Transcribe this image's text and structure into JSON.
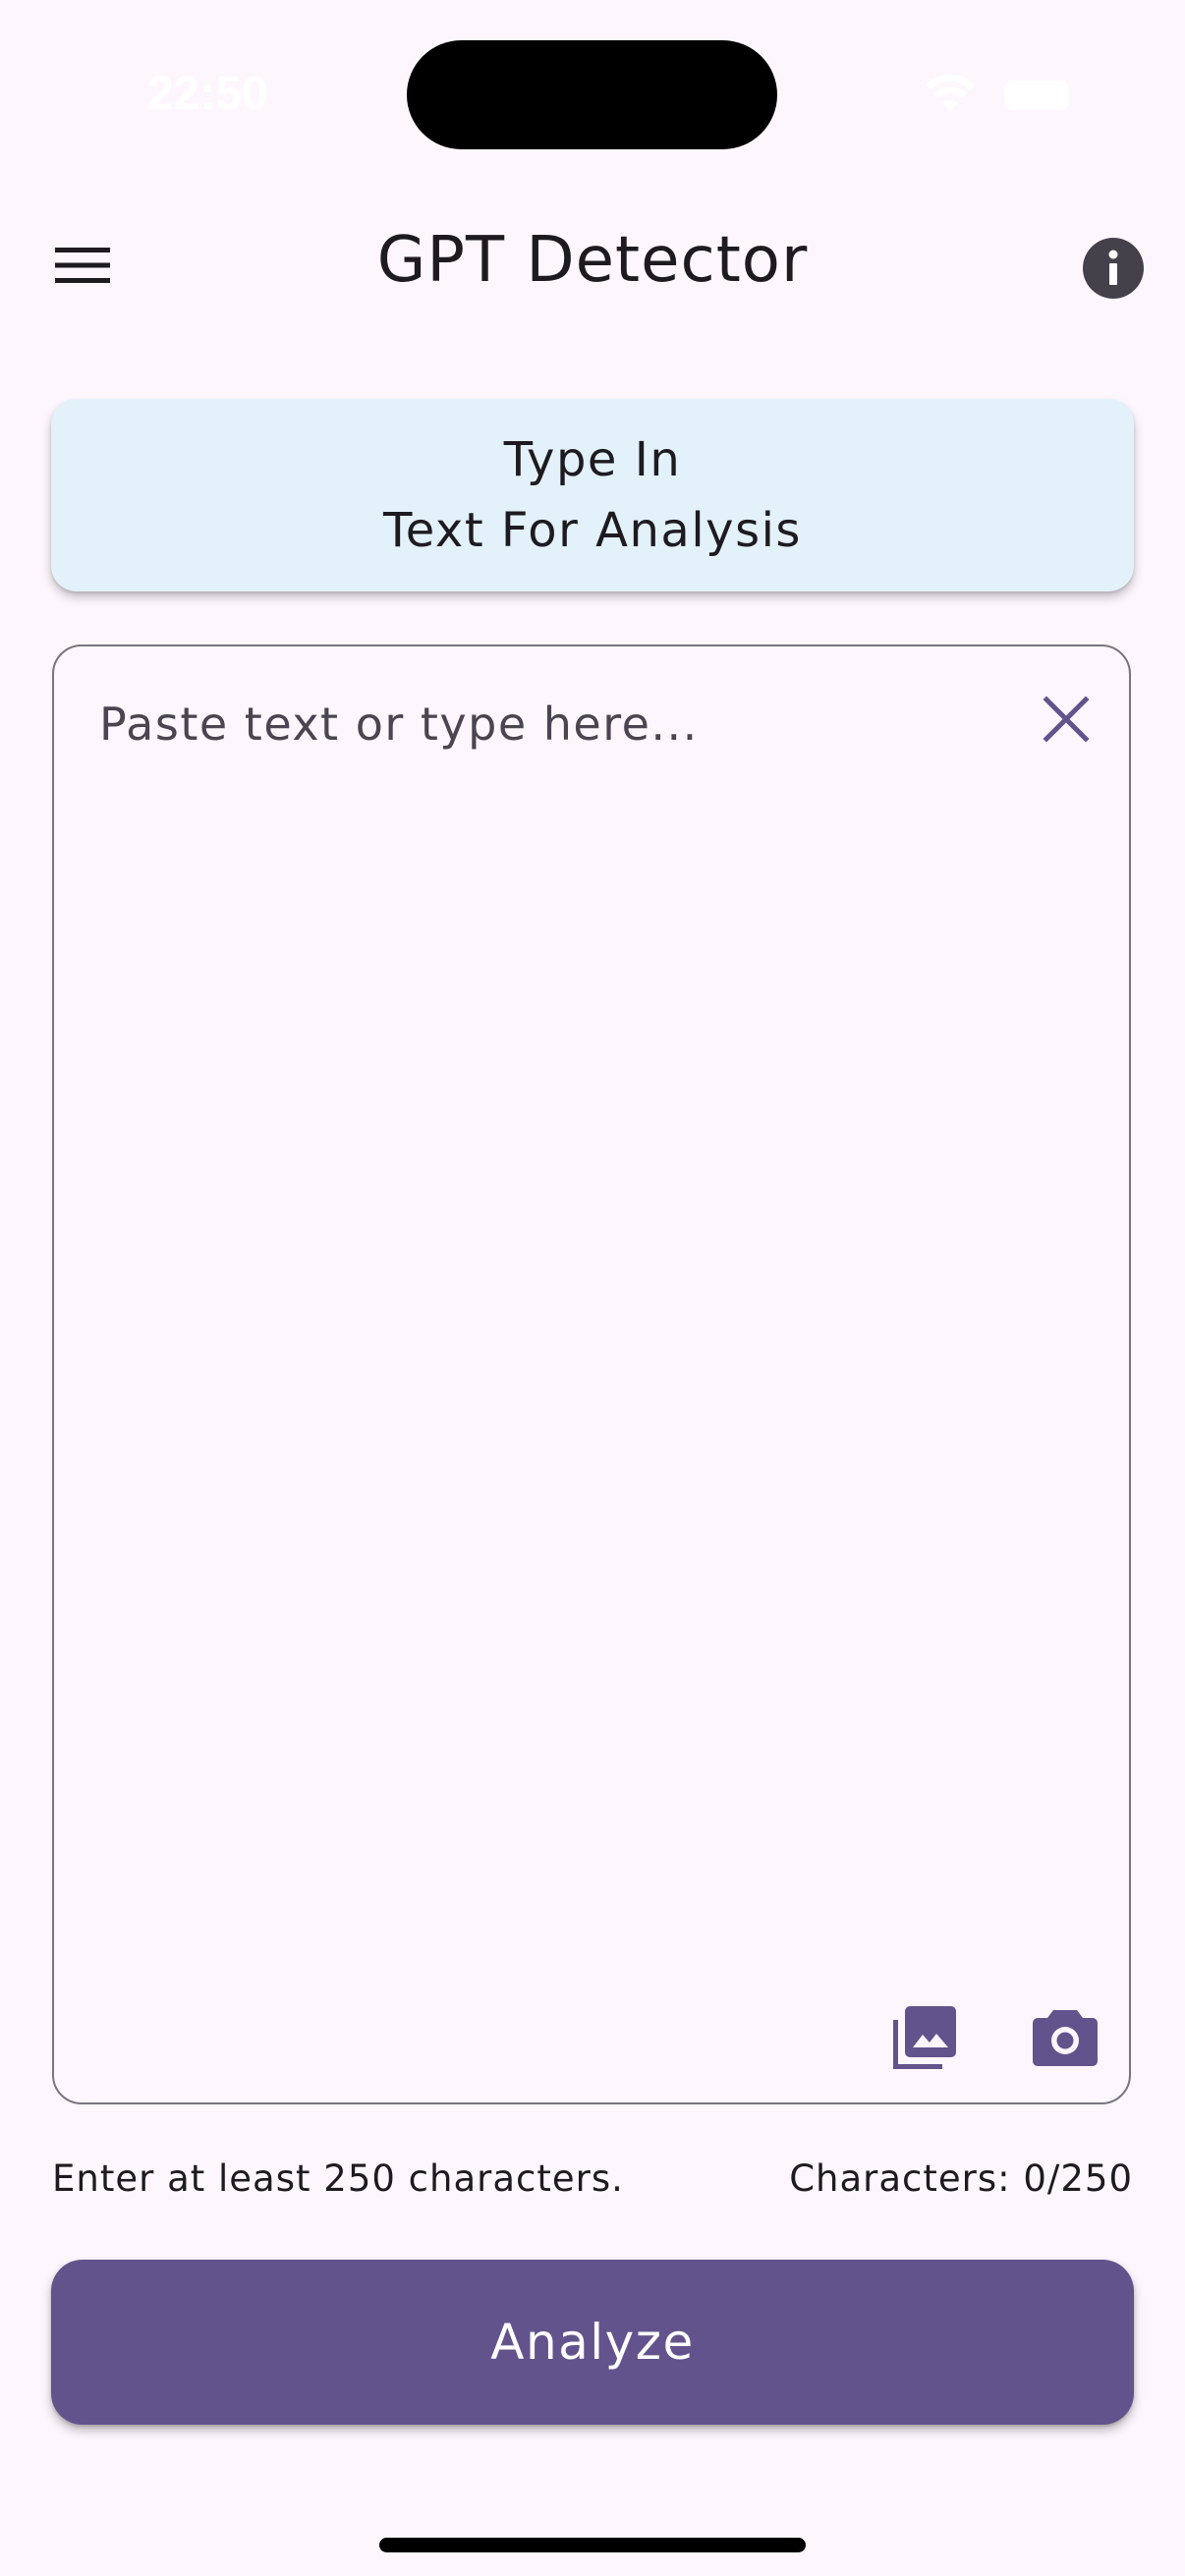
{
  "status_bar": {
    "time": "22:50"
  },
  "app_bar": {
    "title": "GPT Detector"
  },
  "mode_card": {
    "line1": "Type In",
    "line2": "Text For Analysis"
  },
  "text_input": {
    "value": "",
    "placeholder": "Paste text or type here..."
  },
  "hints": {
    "requirement": "Enter at least 250 characters.",
    "counter": "Characters: 0/250"
  },
  "actions": {
    "analyze_label": "Analyze"
  },
  "icons": {
    "menu": "hamburger-menu-icon",
    "info": "info-icon",
    "clear": "close-icon",
    "gallery": "photo-library-icon",
    "camera": "camera-icon"
  },
  "colors": {
    "background": "#fdf7fd",
    "card": "#e3f1fb",
    "accent": "#63538c",
    "border": "#79747e"
  }
}
